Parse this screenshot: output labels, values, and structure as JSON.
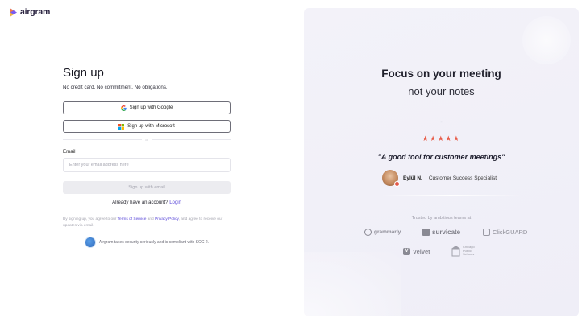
{
  "brand": {
    "name": "airgram",
    "colors": {
      "primary": "#5a48d9",
      "star": "#e85d4a",
      "panel_bg": "#f2f1f8"
    }
  },
  "signup": {
    "title": "Sign up",
    "subtitle": "No credit card. No commitment. No obligations.",
    "google_label": "Sign up with Google",
    "microsoft_label": "Sign up with Microsoft",
    "divider": "or",
    "email_label": "Email",
    "email_placeholder": "Enter your email address here",
    "email_value": "",
    "submit_label": "Sign up with email",
    "login_prompt": "Already have an account?",
    "login_link": "Login",
    "terms_prefix": "By signing up, you agree to our",
    "terms_link": "Terms of Service",
    "terms_and": "and",
    "privacy_link": "Privacy Policy",
    "terms_suffix": ", and agree to receive our updates via email.",
    "security_note": "Airgram takes security seriously and is compliant with SOC 2."
  },
  "testimonial": {
    "headline": "Focus on your meeting",
    "subheadline": "not your notes",
    "quote_mark": "“",
    "rating": 4.5,
    "stars": "★★★★★",
    "quote": "\"A good tool for customer meetings\"",
    "reviewer_name": "Eylül N.",
    "reviewer_role": "Customer Success Specialist"
  },
  "trusted": {
    "caption": "Trusted by ambitious teams at",
    "logos": [
      {
        "name": "grammarly",
        "icon": "grammarly-icon"
      },
      {
        "name": "survicate",
        "icon": "survicate-icon"
      },
      {
        "name": "ClickGUARD",
        "icon": "clickguard-icon"
      },
      {
        "name": "Velvet",
        "icon": "velvet-icon"
      },
      {
        "name": "Chicago Public Schools",
        "icon": "cps-icon"
      }
    ]
  }
}
